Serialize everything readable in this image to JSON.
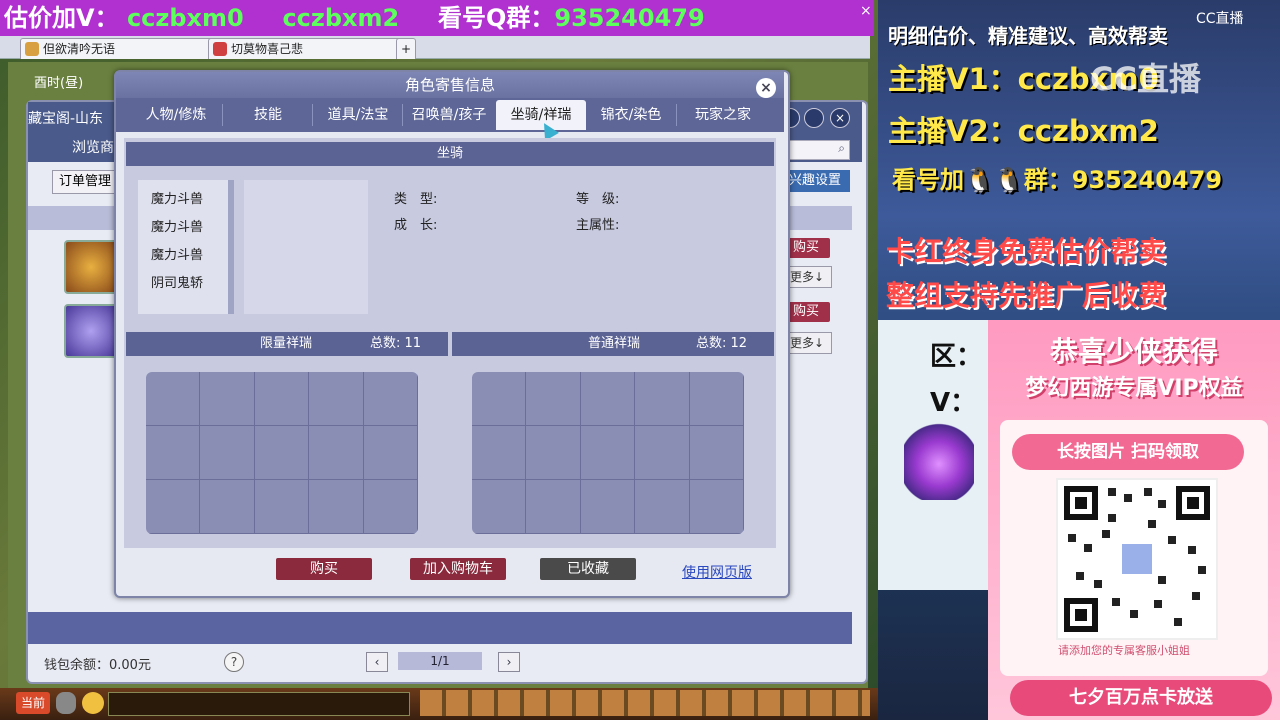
{
  "banner": {
    "prefix": "估价加V：",
    "v1": "cczbxm0",
    "v2": "cczbxm2",
    "qgroup_label": "看号Q群：",
    "qgroup": "935240479",
    "close": "×"
  },
  "browser_tabs": [
    {
      "label": "但欲清吟无语",
      "close": "×"
    },
    {
      "label": "切莫物喜己悲",
      "close": "×"
    },
    {
      "label": "+"
    }
  ],
  "game": {
    "time": "酉时(昼)",
    "outer_tab_left": "藏宝阁-山东",
    "outer_tab_browse": "浏览商",
    "order_mgmt": "订单管理",
    "interest_settings": "兴趣设置",
    "side_buttons": [
      {
        "buy": "购买",
        "more": "更多↓"
      },
      {
        "buy": "购买",
        "more": "更多↓"
      }
    ],
    "wallet": "钱包余额：0.00元",
    "help": "?",
    "pager": {
      "prev": "‹",
      "label": "1/1",
      "next": "›"
    },
    "taskbar_now": "当前"
  },
  "modal": {
    "title": "角色寄售信息",
    "close": "×",
    "tabs": [
      "人物/修炼",
      "技能",
      "道具/法宝",
      "召唤兽/孩子",
      "坐骑/祥瑞",
      "锦衣/染色",
      "玩家之家"
    ],
    "active_tab": 4,
    "mount_section": "坐骑",
    "mount_list": [
      "魔力斗兽",
      "魔力斗兽",
      "魔力斗兽",
      "阴司鬼轿"
    ],
    "attrs": {
      "type": "类　型:",
      "grade": "等　级:",
      "growth": "成　长:",
      "main_attr": "主属性:"
    },
    "limited": {
      "title": "限量祥瑞",
      "count": "总数: 11"
    },
    "normal": {
      "title": "普通祥瑞",
      "count": "总数: 12"
    },
    "buttons": {
      "buy": "购买",
      "add_cart": "加入购物车",
      "favorited": "已收藏",
      "web": "使用网页版"
    }
  },
  "stream": {
    "line1": "明细估价、精准建议、高效帮卖",
    "line2": "主播V1：cczbxm0",
    "line3": "主播V2：cczbxm2",
    "line4": "看号加🐧🐧群：935240479",
    "line5": "卡红终身免费估价帮卖",
    "line6": "整组支持先推广后收费",
    "cc_logo": "CC直播",
    "cc_watermark": "CC直播",
    "zone": "区：",
    "v": "V：",
    "vip_t1": "恭喜少侠获得",
    "vip_t2": "梦幻西游专属VIP权益",
    "vip_scan": "长按图片 扫码领取",
    "vip_sub": "请添加您的专属客服小姐姐",
    "vip_bottom": "七夕百万点卡放送"
  },
  "colors": {
    "modal_header": "#5d6696",
    "buy_red": "#8a2a3c",
    "fav_gray": "#4a4a4a",
    "banner_purple": "#b030d0"
  }
}
